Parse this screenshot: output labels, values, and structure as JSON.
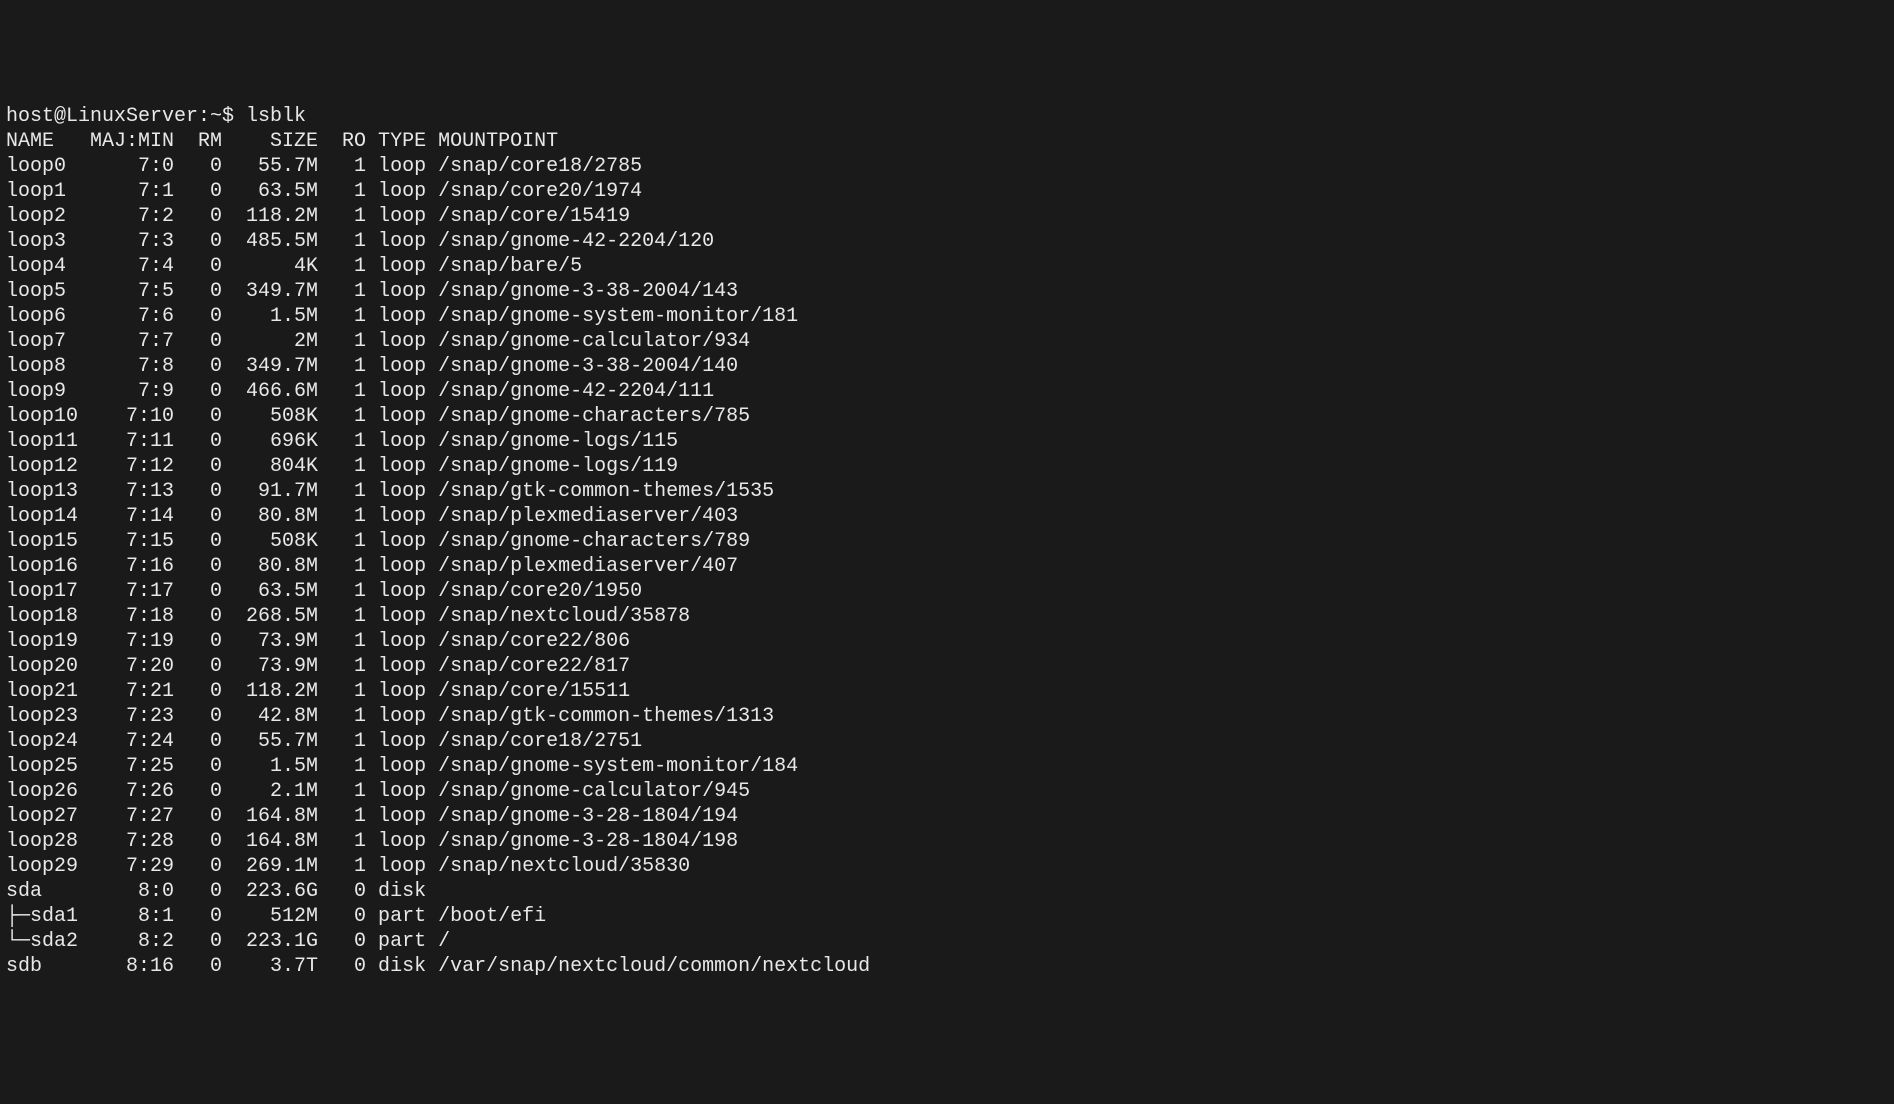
{
  "prompt": "host@LinuxServer:~$ ",
  "command": "lsblk",
  "headers": {
    "name": "NAME",
    "majmin": "MAJ:MIN",
    "rm": "RM",
    "size": "SIZE",
    "ro": "RO",
    "type": "TYPE",
    "mountpoint": "MOUNTPOINT"
  },
  "rows": [
    {
      "name": "loop0",
      "majmin": "7:0",
      "rm": "0",
      "size": "55.7M",
      "ro": "1",
      "type": "loop",
      "mountpoint": "/snap/core18/2785"
    },
    {
      "name": "loop1",
      "majmin": "7:1",
      "rm": "0",
      "size": "63.5M",
      "ro": "1",
      "type": "loop",
      "mountpoint": "/snap/core20/1974"
    },
    {
      "name": "loop2",
      "majmin": "7:2",
      "rm": "0",
      "size": "118.2M",
      "ro": "1",
      "type": "loop",
      "mountpoint": "/snap/core/15419"
    },
    {
      "name": "loop3",
      "majmin": "7:3",
      "rm": "0",
      "size": "485.5M",
      "ro": "1",
      "type": "loop",
      "mountpoint": "/snap/gnome-42-2204/120"
    },
    {
      "name": "loop4",
      "majmin": "7:4",
      "rm": "0",
      "size": "4K",
      "ro": "1",
      "type": "loop",
      "mountpoint": "/snap/bare/5"
    },
    {
      "name": "loop5",
      "majmin": "7:5",
      "rm": "0",
      "size": "349.7M",
      "ro": "1",
      "type": "loop",
      "mountpoint": "/snap/gnome-3-38-2004/143"
    },
    {
      "name": "loop6",
      "majmin": "7:6",
      "rm": "0",
      "size": "1.5M",
      "ro": "1",
      "type": "loop",
      "mountpoint": "/snap/gnome-system-monitor/181"
    },
    {
      "name": "loop7",
      "majmin": "7:7",
      "rm": "0",
      "size": "2M",
      "ro": "1",
      "type": "loop",
      "mountpoint": "/snap/gnome-calculator/934"
    },
    {
      "name": "loop8",
      "majmin": "7:8",
      "rm": "0",
      "size": "349.7M",
      "ro": "1",
      "type": "loop",
      "mountpoint": "/snap/gnome-3-38-2004/140"
    },
    {
      "name": "loop9",
      "majmin": "7:9",
      "rm": "0",
      "size": "466.6M",
      "ro": "1",
      "type": "loop",
      "mountpoint": "/snap/gnome-42-2204/111"
    },
    {
      "name": "loop10",
      "majmin": "7:10",
      "rm": "0",
      "size": "508K",
      "ro": "1",
      "type": "loop",
      "mountpoint": "/snap/gnome-characters/785"
    },
    {
      "name": "loop11",
      "majmin": "7:11",
      "rm": "0",
      "size": "696K",
      "ro": "1",
      "type": "loop",
      "mountpoint": "/snap/gnome-logs/115"
    },
    {
      "name": "loop12",
      "majmin": "7:12",
      "rm": "0",
      "size": "804K",
      "ro": "1",
      "type": "loop",
      "mountpoint": "/snap/gnome-logs/119"
    },
    {
      "name": "loop13",
      "majmin": "7:13",
      "rm": "0",
      "size": "91.7M",
      "ro": "1",
      "type": "loop",
      "mountpoint": "/snap/gtk-common-themes/1535"
    },
    {
      "name": "loop14",
      "majmin": "7:14",
      "rm": "0",
      "size": "80.8M",
      "ro": "1",
      "type": "loop",
      "mountpoint": "/snap/plexmediaserver/403"
    },
    {
      "name": "loop15",
      "majmin": "7:15",
      "rm": "0",
      "size": "508K",
      "ro": "1",
      "type": "loop",
      "mountpoint": "/snap/gnome-characters/789"
    },
    {
      "name": "loop16",
      "majmin": "7:16",
      "rm": "0",
      "size": "80.8M",
      "ro": "1",
      "type": "loop",
      "mountpoint": "/snap/plexmediaserver/407"
    },
    {
      "name": "loop17",
      "majmin": "7:17",
      "rm": "0",
      "size": "63.5M",
      "ro": "1",
      "type": "loop",
      "mountpoint": "/snap/core20/1950"
    },
    {
      "name": "loop18",
      "majmin": "7:18",
      "rm": "0",
      "size": "268.5M",
      "ro": "1",
      "type": "loop",
      "mountpoint": "/snap/nextcloud/35878"
    },
    {
      "name": "loop19",
      "majmin": "7:19",
      "rm": "0",
      "size": "73.9M",
      "ro": "1",
      "type": "loop",
      "mountpoint": "/snap/core22/806"
    },
    {
      "name": "loop20",
      "majmin": "7:20",
      "rm": "0",
      "size": "73.9M",
      "ro": "1",
      "type": "loop",
      "mountpoint": "/snap/core22/817"
    },
    {
      "name": "loop21",
      "majmin": "7:21",
      "rm": "0",
      "size": "118.2M",
      "ro": "1",
      "type": "loop",
      "mountpoint": "/snap/core/15511"
    },
    {
      "name": "loop23",
      "majmin": "7:23",
      "rm": "0",
      "size": "42.8M",
      "ro": "1",
      "type": "loop",
      "mountpoint": "/snap/gtk-common-themes/1313"
    },
    {
      "name": "loop24",
      "majmin": "7:24",
      "rm": "0",
      "size": "55.7M",
      "ro": "1",
      "type": "loop",
      "mountpoint": "/snap/core18/2751"
    },
    {
      "name": "loop25",
      "majmin": "7:25",
      "rm": "0",
      "size": "1.5M",
      "ro": "1",
      "type": "loop",
      "mountpoint": "/snap/gnome-system-monitor/184"
    },
    {
      "name": "loop26",
      "majmin": "7:26",
      "rm": "0",
      "size": "2.1M",
      "ro": "1",
      "type": "loop",
      "mountpoint": "/snap/gnome-calculator/945"
    },
    {
      "name": "loop27",
      "majmin": "7:27",
      "rm": "0",
      "size": "164.8M",
      "ro": "1",
      "type": "loop",
      "mountpoint": "/snap/gnome-3-28-1804/194"
    },
    {
      "name": "loop28",
      "majmin": "7:28",
      "rm": "0",
      "size": "164.8M",
      "ro": "1",
      "type": "loop",
      "mountpoint": "/snap/gnome-3-28-1804/198"
    },
    {
      "name": "loop29",
      "majmin": "7:29",
      "rm": "0",
      "size": "269.1M",
      "ro": "1",
      "type": "loop",
      "mountpoint": "/snap/nextcloud/35830"
    },
    {
      "name": "sda",
      "majmin": "8:0",
      "rm": "0",
      "size": "223.6G",
      "ro": "0",
      "type": "disk",
      "mountpoint": ""
    },
    {
      "name": "├─sda1",
      "majmin": "8:1",
      "rm": "0",
      "size": "512M",
      "ro": "0",
      "type": "part",
      "mountpoint": "/boot/efi"
    },
    {
      "name": "└─sda2",
      "majmin": "8:2",
      "rm": "0",
      "size": "223.1G",
      "ro": "0",
      "type": "part",
      "mountpoint": "/"
    },
    {
      "name": "sdb",
      "majmin": "8:16",
      "rm": "0",
      "size": "3.7T",
      "ro": "0",
      "type": "disk",
      "mountpoint": "/var/snap/nextcloud/common/nextcloud"
    }
  ]
}
